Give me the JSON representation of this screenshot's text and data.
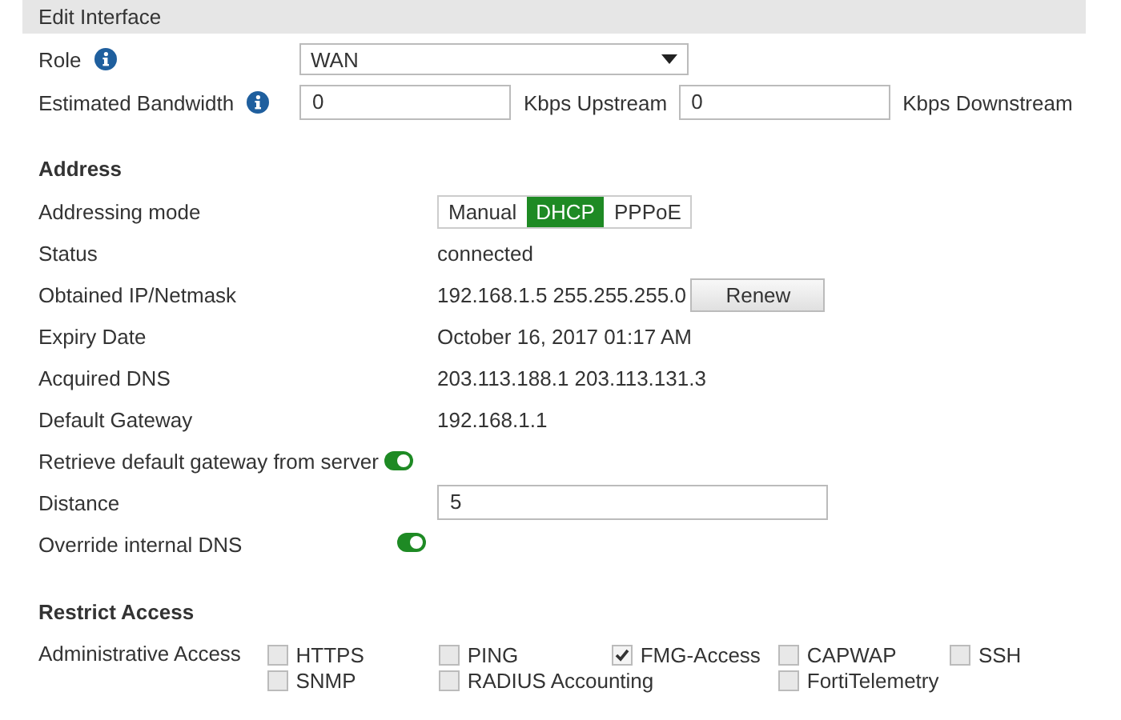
{
  "panel": {
    "title": "Edit Interface"
  },
  "role": {
    "label": "Role",
    "value": "WAN"
  },
  "bandwidth": {
    "label": "Estimated Bandwidth",
    "upstream": "0",
    "upstream_unit": "Kbps Upstream",
    "downstream": "0",
    "downstream_unit": "Kbps Downstream"
  },
  "address": {
    "heading": "Address",
    "rows": [
      {
        "kind": "segmented",
        "label": "Addressing mode",
        "options": [
          {
            "label": "Manual",
            "selected": false
          },
          {
            "label": "DHCP",
            "selected": true
          },
          {
            "label": "PPPoE",
            "selected": false
          }
        ]
      },
      {
        "kind": "text",
        "label": "Status",
        "value": "connected"
      },
      {
        "kind": "text-button",
        "label": "Obtained IP/Netmask",
        "value": "192.168.1.5 255.255.255.0",
        "button": "Renew"
      },
      {
        "kind": "text",
        "label": "Expiry Date",
        "value": "October 16, 2017 01:17 AM"
      },
      {
        "kind": "text",
        "label": "Acquired DNS",
        "value": "203.113.188.1  203.113.131.3"
      },
      {
        "kind": "text",
        "label": "Default Gateway",
        "value": "192.168.1.1"
      },
      {
        "kind": "toggle-inline",
        "label": "Retrieve default gateway from server",
        "on": true
      },
      {
        "kind": "input",
        "label": "Distance",
        "value": "5"
      },
      {
        "kind": "toggle",
        "label": "Override internal DNS",
        "on": true
      }
    ]
  },
  "restrict": {
    "heading": "Restrict Access",
    "label": "Administrative Access",
    "columns": [
      [
        {
          "label": "HTTPS",
          "checked": false
        },
        {
          "label": "SNMP",
          "checked": false
        }
      ],
      [
        {
          "label": "PING",
          "checked": false
        },
        {
          "label": "RADIUS Accounting",
          "checked": false
        }
      ],
      [
        {
          "label": "FMG-Access",
          "checked": true
        }
      ],
      [
        {
          "label": "CAPWAP",
          "checked": false
        },
        {
          "label": "FortiTelemetry",
          "checked": false
        }
      ],
      [
        {
          "label": "SSH",
          "checked": false
        }
      ]
    ]
  }
}
